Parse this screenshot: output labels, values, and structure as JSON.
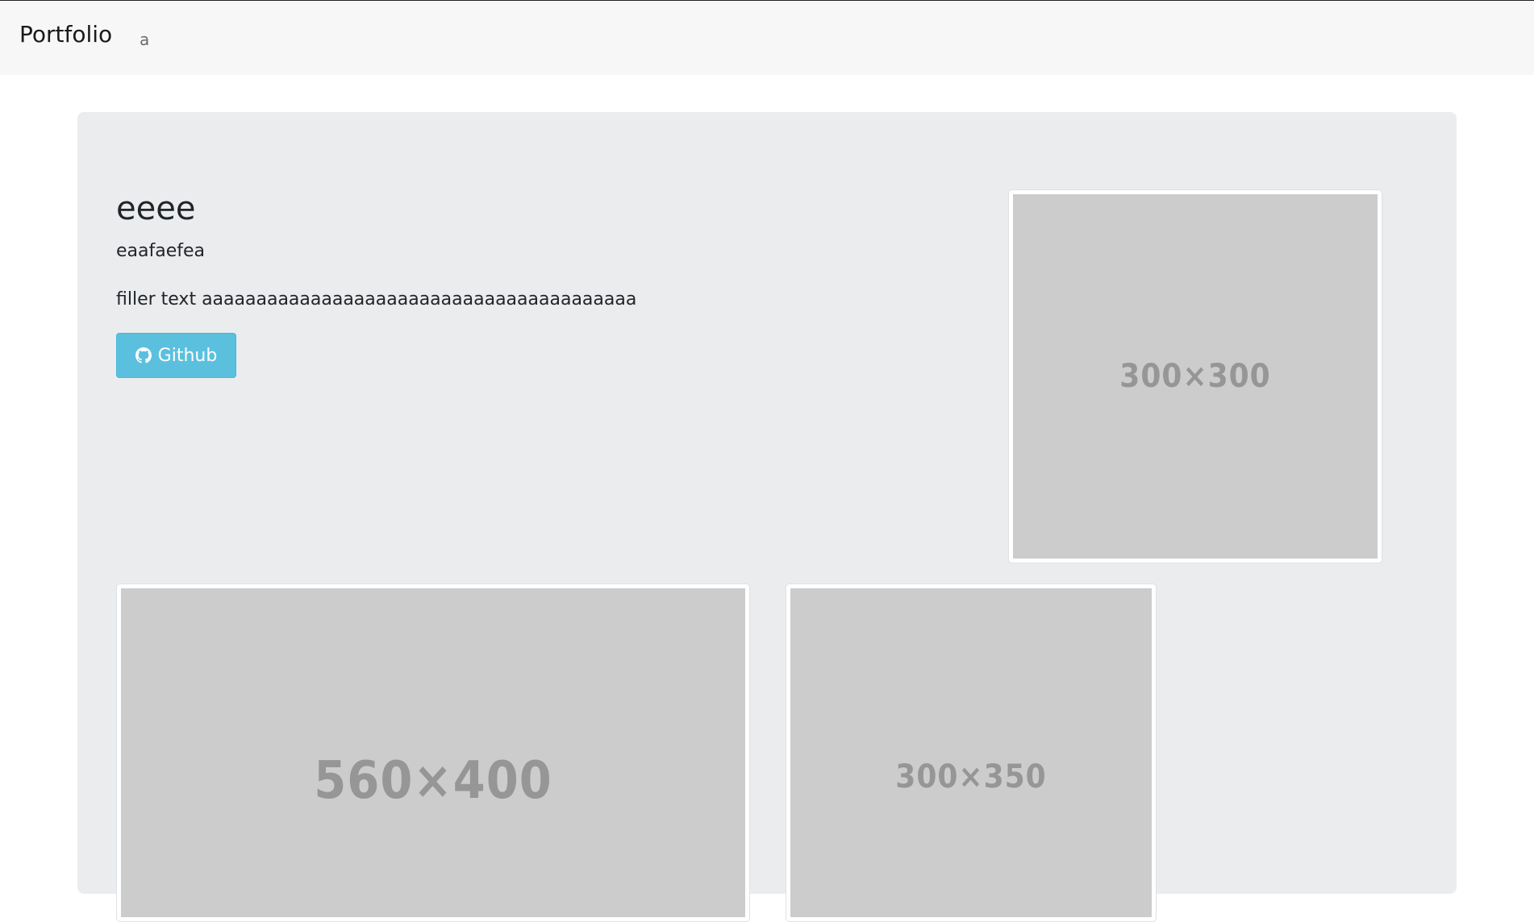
{
  "navbar": {
    "brand": "Portfolio",
    "links": [
      "a"
    ]
  },
  "hero": {
    "title": "eeee",
    "subtitle": "eaafaefea",
    "filler": "filler text aaaaaaaaaaaaaaaaaaaaaaaaaaaaaaaaaaaaaaaa",
    "button_label": "Github",
    "button_icon": "github-icon",
    "button_color": "#5bc0de"
  },
  "images": {
    "profile": "300×300",
    "project_1": "560×400",
    "project_2": "300×350"
  },
  "colors": {
    "navbar_bg": "#f7f7f7",
    "jumbotron_bg": "#ebecee",
    "placeholder_bg": "#cccccc"
  }
}
